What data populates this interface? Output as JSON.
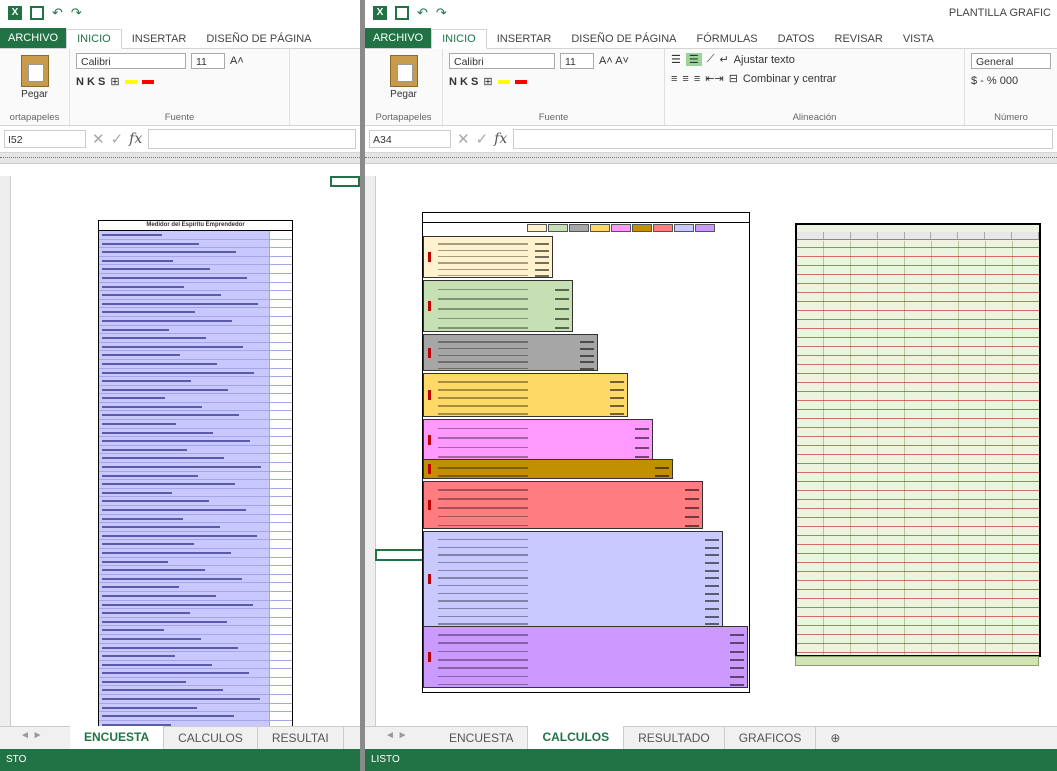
{
  "left": {
    "tabs": [
      "ARCHIVO",
      "INICIO",
      "INSERTAR",
      "DISEÑO DE PÁGINA"
    ],
    "ribbon": {
      "paste": "Pegar",
      "font_name": "Calibri",
      "font_size": "11",
      "clipboard_label": "ortapapeles",
      "font_label": "Fuente",
      "format_letters": "N  K  S"
    },
    "name_box": "I52",
    "sheet_tabs": [
      "ENCUESTA",
      "CALCULOS",
      "RESULTAI"
    ],
    "active_sheet": "ENCUESTA",
    "survey_title": "Medidor del Espíritu Emprendedor",
    "status": "STO"
  },
  "right": {
    "title": "PLANTILLA GRAFIC",
    "tabs": [
      "ARCHIVO",
      "INICIO",
      "INSERTAR",
      "DISEÑO DE PÁGINA",
      "FÓRMULAS",
      "DATOS",
      "REVISAR",
      "VISTA"
    ],
    "ribbon": {
      "paste": "Pegar",
      "font_name": "Calibri",
      "font_size": "11",
      "wrap_text": "Ajustar texto",
      "merge_center": "Combinar y centrar",
      "number_format": "General",
      "currency": "$  -  %  000",
      "clipboard_label": "Portapapeles",
      "font_label": "Fuente",
      "alignment_label": "Alineación",
      "number_label": "Número",
      "format_letters": "N  K  S"
    },
    "name_box": "A34",
    "sheet_tabs": [
      "ENCUESTA",
      "CALCULOS",
      "RESULTADO",
      "GRAFICOS"
    ],
    "active_sheet": "CALCULOS",
    "add_sheet": "⊕",
    "status": "LISTO"
  },
  "colors": {
    "excel_green": "#217346",
    "survey_blue": "#c8c8ff",
    "pyramid": [
      "#fff2cc",
      "#c6e0b4",
      "#a6a6a6",
      "#ffd966",
      "#ff99ff",
      "#c09000",
      "#ff7c80",
      "#c9c9ff",
      "#cc99ff"
    ],
    "table_green": "#eaf4df"
  }
}
